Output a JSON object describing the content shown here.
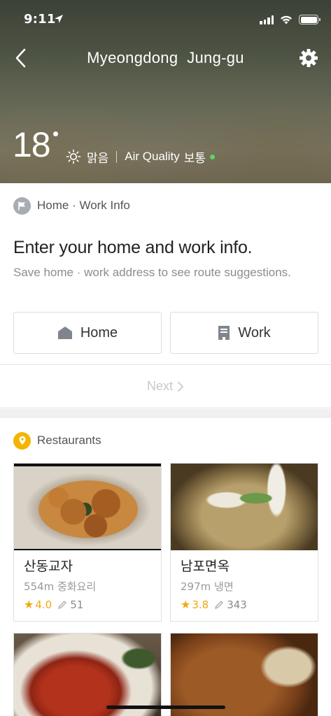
{
  "status_bar": {
    "time": "9:11"
  },
  "header": {
    "title": "Myeongdong  Jung-gu",
    "temperature": "18",
    "weather": "맑음",
    "air_quality_label": "Air Quality",
    "air_quality_value": "보통",
    "air_quality_color": "#5fd35f"
  },
  "home_work": {
    "section_title": "Home · Work Info",
    "heading": "Enter your home and work info.",
    "subtext": "Save home · work address to see route suggestions.",
    "home_label": "Home",
    "work_label": "Work",
    "next_label": "Next"
  },
  "restaurants": {
    "section_title": "Restaurants",
    "accent_color": "#f5b400",
    "items": [
      {
        "name": "산동교자",
        "distance": "554m",
        "category": "중화요리",
        "rating": "4.0",
        "reviews": "51"
      },
      {
        "name": "남포면옥",
        "distance": "297m",
        "category": "냉면",
        "rating": "3.8",
        "reviews": "343"
      },
      {
        "name": "",
        "distance": "",
        "category": "",
        "rating": "",
        "reviews": ""
      },
      {
        "name": "",
        "distance": "",
        "category": "",
        "rating": "",
        "reviews": ""
      }
    ]
  }
}
